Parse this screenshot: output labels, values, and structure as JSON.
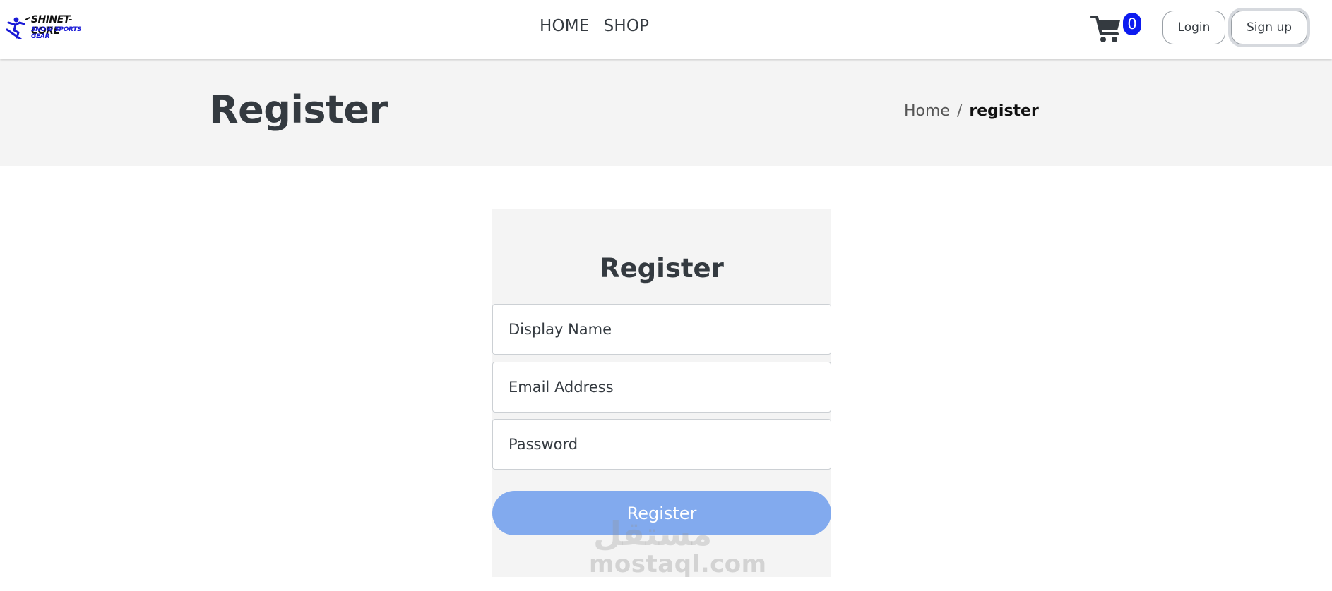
{
  "brand": {
    "name": "SHINET-CORE",
    "tagline": "SNOW SPORTS GEAR"
  },
  "nav": {
    "items": [
      "HOME",
      "SHOP"
    ]
  },
  "cart": {
    "count": "0"
  },
  "auth": {
    "login_label": "Login",
    "signup_label": "Sign up"
  },
  "header": {
    "title": "Register",
    "breadcrumb": {
      "home": "Home",
      "separator": "/",
      "current": "register"
    }
  },
  "form": {
    "title": "Register",
    "display_name_placeholder": "Display Name",
    "email_placeholder": "Email Address",
    "password_placeholder": "Password",
    "submit_label": "Register"
  },
  "watermark": {
    "arabic": "مستقل",
    "latin": "mostaql.com"
  },
  "colors": {
    "badge": "#0d1bf0",
    "register_button": "#82aaee",
    "header_band": "#f4f4f4",
    "logo_blue": "#1a1ad6"
  }
}
